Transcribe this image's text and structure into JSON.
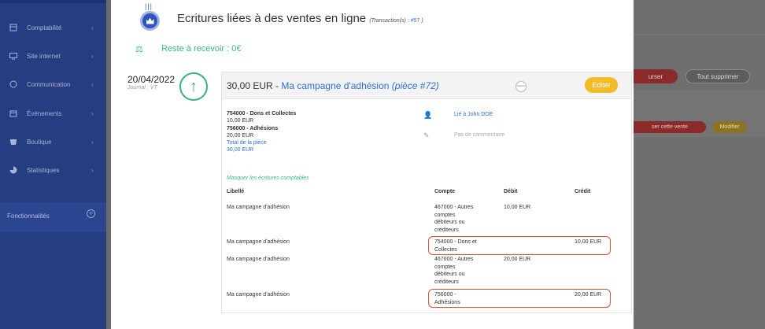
{
  "sidebar": {
    "items": [
      {
        "label": "Comptabilité",
        "icon": "accounting-icon",
        "chevron": "›"
      },
      {
        "label": "Site internet",
        "icon": "website-icon",
        "chevron": "›"
      },
      {
        "label": "Communication",
        "icon": "communication-icon",
        "chevron": "›"
      },
      {
        "label": "Événements",
        "icon": "calendar-icon",
        "chevron": "›"
      },
      {
        "label": "Boutique",
        "icon": "shop-icon",
        "chevron": "›"
      },
      {
        "label": "Statistiques",
        "icon": "stats-icon",
        "chevron": "›"
      }
    ],
    "features_label": "Fonctionnalités",
    "features_plus": "+"
  },
  "background": {
    "btn_partial_red": "urser",
    "btn_delete_all": "Tout supprimer",
    "btn_partial_sale": "ser cette vente",
    "btn_modify": "Modifier"
  },
  "modal": {
    "title": "Ecritures liées à des ventes en ligne",
    "title_sub_prefix": "(Transaction(s) : ",
    "title_sub_link": "#57",
    "title_sub_suffix": " )",
    "title_bars": "|||",
    "remaining_icon": "⚖",
    "remaining": "Reste à recevoir : 0€",
    "date": "20/04/2022",
    "journal": "Journal : VT",
    "arrow": "↑",
    "amount": "30,00 EUR - ",
    "campaign": "Ma campagne d'adhésion",
    "piece": " (pièce #72)",
    "edit_label": "Editer",
    "collapse_label": "—",
    "accounts": {
      "line1": "754000 - Dons et Collectes",
      "line1_amt": "10,00 EUR",
      "line2": "756000 - Adhésions",
      "line2_amt": "20,00 EUR",
      "total_label": "Total de la pièce",
      "total_amt": "30,00 EUR"
    },
    "linked_icon": "👤",
    "linked_user": "Lié à John DOE",
    "comment_icon": "✎",
    "no_comment": "Pas de commentaire",
    "hide_entries": "Masquer les écritures comptables",
    "table": {
      "headers": [
        "Libellé",
        "Compte",
        "Débit",
        "Crédit"
      ],
      "rows": [
        {
          "label": "Ma campagne d'adhésion",
          "account": [
            "467000 - Autres",
            "comptes",
            "débiteurs ou",
            "créditeurs"
          ],
          "debit": "10,00 EUR",
          "credit": ""
        },
        {
          "label": "Ma campagne d'adhésion",
          "account": [
            "754000 - Dons et",
            "Collectes"
          ],
          "debit": "",
          "credit": "10,00 EUR"
        },
        {
          "label": "Ma campagne d'adhésion",
          "account": [
            "467000 - Autres",
            "comptes",
            "débiteurs ou",
            "créditeurs"
          ],
          "debit": "20,00 EUR",
          "credit": ""
        },
        {
          "label": "Ma campagne d'adhésion",
          "account": [
            "756000 -",
            "Adhésions"
          ],
          "debit": "",
          "credit": "20,00 EUR"
        }
      ]
    }
  },
  "colors": {
    "accent_green": "#3ab58a",
    "link_blue": "#2e6fd9",
    "edit_yellow": "#f2bc28",
    "highlight_red": "#e0513a",
    "sidebar_blue": "#263d82"
  }
}
